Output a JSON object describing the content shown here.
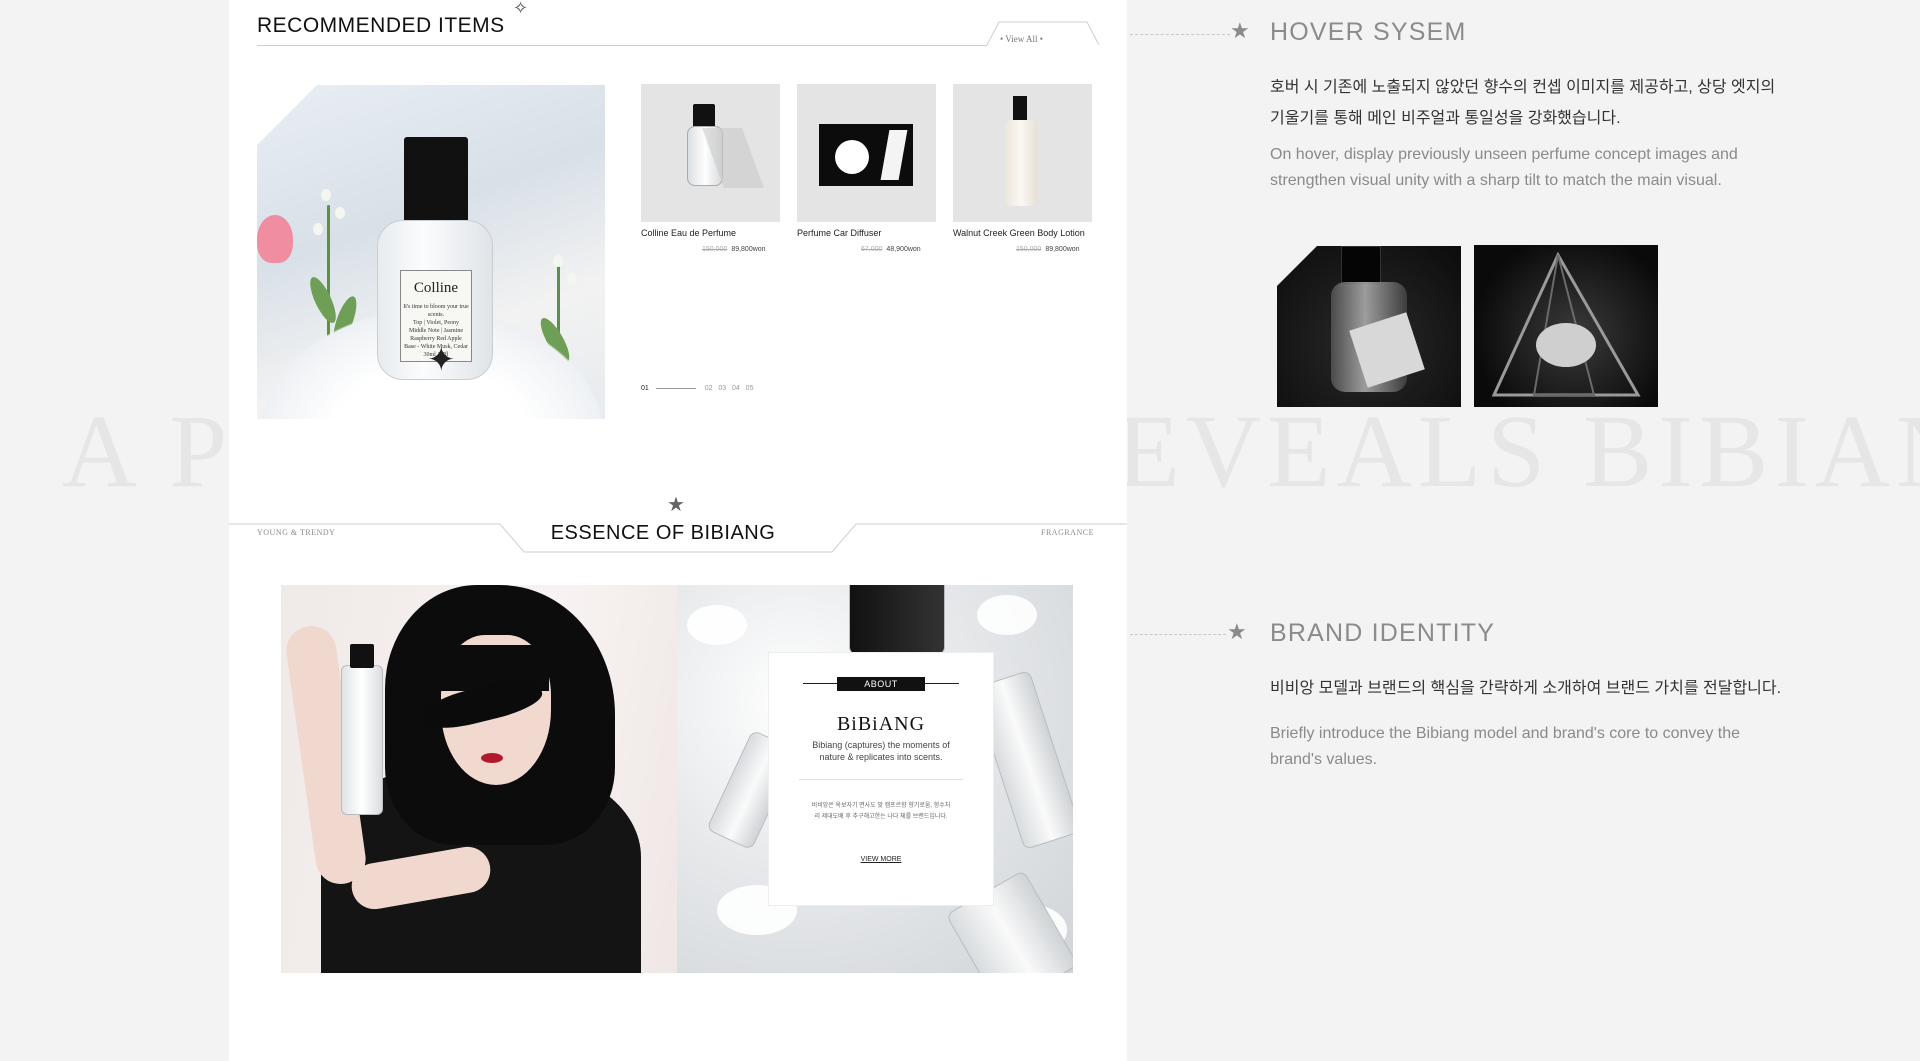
{
  "background_text": "A PERFUME THAT REVEALS BIBIANG'S CHARM",
  "recommended": {
    "title": "RECOMMENDED ITEMS",
    "view_all": "• View All •",
    "main_label": {
      "name": "Colline",
      "lines": [
        "It's time to bloom your true scents.",
        "Top | Violet, Peony",
        "Middle Note | Jasmine",
        "Raspberry Red Apple",
        "Base - White Musk, Cedar",
        "30ml 1.7fl"
      ]
    },
    "products": [
      {
        "name": "Colline Eau de Perfume",
        "old_price": "150,000",
        "price": "89,800won"
      },
      {
        "name": "Perfume Car Diffuser",
        "old_price": "67,000",
        "price": "48,900won"
      },
      {
        "name": "Walnut Creek Green Body Lotion",
        "old_price": "150,000",
        "price": "89,800won"
      }
    ],
    "pagination": {
      "current": "01",
      "pages": [
        "02",
        "03",
        "04",
        "05"
      ]
    }
  },
  "essence": {
    "left_label": "YOUNG & TRENDY",
    "title": "ESSENCE OF BIBIANG",
    "right_label": "FRAGRANCE",
    "card": {
      "tag": "ABOUT",
      "name": "BiBiANG",
      "desc": "Bibiang (captures) the moments of nature & replicates into scents.",
      "kor": "비비앙은 옥보자기 면사도 맞 캠프르향 향기로움, 향수처리 제대도배 후 추구해고한는 나다 체를 브랜드입니다.",
      "more": "VIEW MORE"
    }
  },
  "hover_system": {
    "title": "HOVER SYSEM",
    "kor": "호버 시 기존에 노출되지 않았던 향수의 컨셉 이미지를 제공하고, 상당 엣지의 기울기를 통해 메인 비주얼과 통일성을 강화했습니다.",
    "eng": "On hover, display previously unseen perfume concept images and strengthen visual unity with a sharp tilt to match the main visual."
  },
  "brand_identity": {
    "title": "BRAND IDENTITY",
    "kor": "비비앙 모델과 브랜드의 핵심을 간략하게 소개하여 브랜드 가치를 전달합니다.",
    "eng": "Briefly introduce the Bibiang model and brand's core to convey the brand's values."
  },
  "colors": {
    "panel": "#ffffff",
    "page": "#f3f3f3",
    "accent": "#111111",
    "muted": "#8b8b8b"
  }
}
